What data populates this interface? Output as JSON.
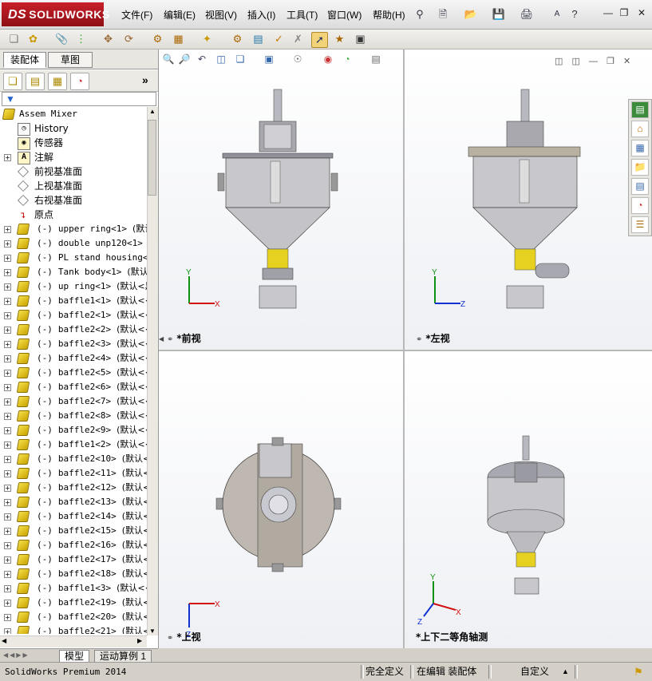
{
  "app": {
    "logo_ds": "DS",
    "logo_text": "SOLIDWORKS"
  },
  "menu": [
    "文件(F)",
    "编辑(E)",
    "视图(V)",
    "插入(I)",
    "工具(T)",
    "窗口(W)",
    "帮助(H)"
  ],
  "quick_access": {
    "search_hint": "A"
  },
  "left_panel": {
    "tabs": [
      "装配体",
      "草图"
    ],
    "root": "Assem Mixer",
    "special_items": [
      "History",
      "传感器",
      "注解",
      "前视基准面",
      "上视基准面",
      "右视基准面",
      "原点"
    ],
    "components": [
      {
        "prefix": "(-)",
        "name": "upper ring<1>",
        "suffix": "(默认"
      },
      {
        "prefix": "(-)",
        "name": "double unp120<1>",
        "suffix": "(黒"
      },
      {
        "prefix": "(-)",
        "name": "PL stand housing<1>",
        "suffix": ""
      },
      {
        "prefix": "(-)",
        "name": "Tank body<1>",
        "suffix": "(默认<"
      },
      {
        "prefix": "(-)",
        "name": "up ring<1>",
        "suffix": "(默认<黒"
      },
      {
        "prefix": "(-)",
        "name": "baffle1<1>",
        "suffix": "(默认<<黒"
      },
      {
        "prefix": "(-)",
        "name": "baffle2<1>",
        "suffix": "(默认<<黒"
      },
      {
        "prefix": "(-)",
        "name": "baffle2<2>",
        "suffix": "(默认<<黒"
      },
      {
        "prefix": "(-)",
        "name": "baffle2<3>",
        "suffix": "(默认<<黒"
      },
      {
        "prefix": "(-)",
        "name": "baffle2<4>",
        "suffix": "(默认<<黒"
      },
      {
        "prefix": "(-)",
        "name": "baffle2<5>",
        "suffix": "(默认<<黒"
      },
      {
        "prefix": "(-)",
        "name": "baffle2<6>",
        "suffix": "(默认<<黒"
      },
      {
        "prefix": "(-)",
        "name": "baffle2<7>",
        "suffix": "(默认<<黒"
      },
      {
        "prefix": "(-)",
        "name": "baffle2<8>",
        "suffix": "(默认<<黒"
      },
      {
        "prefix": "(-)",
        "name": "baffle2<9>",
        "suffix": "(默认<<黒"
      },
      {
        "prefix": "(-)",
        "name": "baffle1<2>",
        "suffix": "(默认<<黒"
      },
      {
        "prefix": "(-)",
        "name": "baffle2<10>",
        "suffix": "(默认<<"
      },
      {
        "prefix": "(-)",
        "name": "baffle2<11>",
        "suffix": "(默认<<"
      },
      {
        "prefix": "(-)",
        "name": "baffle2<12>",
        "suffix": "(默认<<"
      },
      {
        "prefix": "(-)",
        "name": "baffle2<13>",
        "suffix": "(默认<<"
      },
      {
        "prefix": "(-)",
        "name": "baffle2<14>",
        "suffix": "(默认<<"
      },
      {
        "prefix": "(-)",
        "name": "baffle2<15>",
        "suffix": "(默认<<"
      },
      {
        "prefix": "(-)",
        "name": "baffle2<16>",
        "suffix": "(默认<<"
      },
      {
        "prefix": "(-)",
        "name": "baffle2<17>",
        "suffix": "(默认<<"
      },
      {
        "prefix": "(-)",
        "name": "baffle2<18>",
        "suffix": "(默认<<"
      },
      {
        "prefix": "(-)",
        "name": "baffle1<3>",
        "suffix": "(默认<<黒"
      },
      {
        "prefix": "(-)",
        "name": "baffle2<19>",
        "suffix": "(默认<<"
      },
      {
        "prefix": "(-)",
        "name": "baffle2<20>",
        "suffix": "(默认<<"
      },
      {
        "prefix": "(-)",
        "name": "baffle2<21>",
        "suffix": "(默认<<"
      }
    ],
    "bottom_tabs": [
      "模型",
      "运动算例 1"
    ]
  },
  "viewports": [
    {
      "label": "*前视",
      "axes": {
        "h": "X",
        "v": "Y"
      }
    },
    {
      "label": "*左视",
      "axes": {
        "h": "Z",
        "v": "Y"
      }
    },
    {
      "label": "*上视",
      "axes": {
        "h": "X",
        "v": "Z"
      }
    },
    {
      "label": "*上下二等角轴测",
      "axes": {
        "h": "X",
        "v": "Y",
        "d": "Z"
      }
    }
  ],
  "status_bar": {
    "product": "SolidWorks Premium 2014",
    "definition": "完全定义",
    "editing": "在编辑 装配体",
    "units": "自定义"
  },
  "colors": {
    "brand_red": "#b31b23",
    "tank_gray": "#c8c8cc",
    "yellow_coupling": "#e6d020",
    "axis_x": "#d01010",
    "axis_y": "#109010",
    "axis_z": "#1030d0"
  }
}
